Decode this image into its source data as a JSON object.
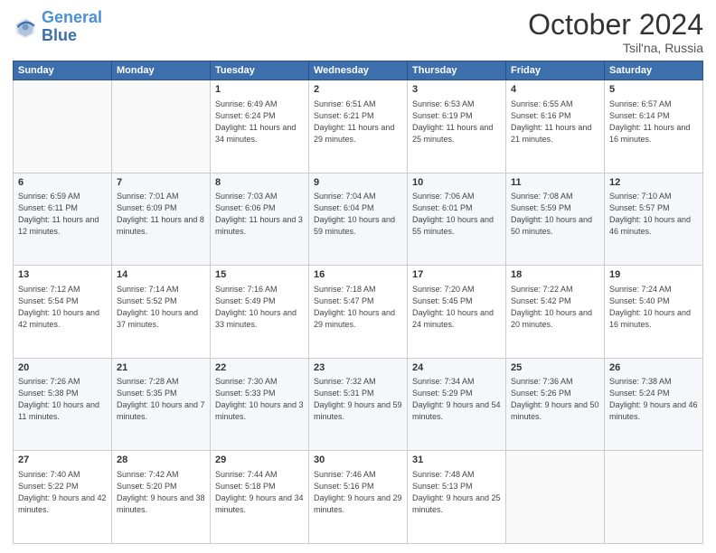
{
  "header": {
    "logo": "GeneralBlue",
    "month": "October 2024",
    "location": "Tsil'na, Russia"
  },
  "weekdays": [
    "Sunday",
    "Monday",
    "Tuesday",
    "Wednesday",
    "Thursday",
    "Friday",
    "Saturday"
  ],
  "weeks": [
    [
      null,
      null,
      {
        "day": 1,
        "sunrise": "6:49 AM",
        "sunset": "6:24 PM",
        "daylight": "11 hours and 34 minutes."
      },
      {
        "day": 2,
        "sunrise": "6:51 AM",
        "sunset": "6:21 PM",
        "daylight": "11 hours and 29 minutes."
      },
      {
        "day": 3,
        "sunrise": "6:53 AM",
        "sunset": "6:19 PM",
        "daylight": "11 hours and 25 minutes."
      },
      {
        "day": 4,
        "sunrise": "6:55 AM",
        "sunset": "6:16 PM",
        "daylight": "11 hours and 21 minutes."
      },
      {
        "day": 5,
        "sunrise": "6:57 AM",
        "sunset": "6:14 PM",
        "daylight": "11 hours and 16 minutes."
      }
    ],
    [
      {
        "day": 6,
        "sunrise": "6:59 AM",
        "sunset": "6:11 PM",
        "daylight": "11 hours and 12 minutes."
      },
      {
        "day": 7,
        "sunrise": "7:01 AM",
        "sunset": "6:09 PM",
        "daylight": "11 hours and 8 minutes."
      },
      {
        "day": 8,
        "sunrise": "7:03 AM",
        "sunset": "6:06 PM",
        "daylight": "11 hours and 3 minutes."
      },
      {
        "day": 9,
        "sunrise": "7:04 AM",
        "sunset": "6:04 PM",
        "daylight": "10 hours and 59 minutes."
      },
      {
        "day": 10,
        "sunrise": "7:06 AM",
        "sunset": "6:01 PM",
        "daylight": "10 hours and 55 minutes."
      },
      {
        "day": 11,
        "sunrise": "7:08 AM",
        "sunset": "5:59 PM",
        "daylight": "10 hours and 50 minutes."
      },
      {
        "day": 12,
        "sunrise": "7:10 AM",
        "sunset": "5:57 PM",
        "daylight": "10 hours and 46 minutes."
      }
    ],
    [
      {
        "day": 13,
        "sunrise": "7:12 AM",
        "sunset": "5:54 PM",
        "daylight": "10 hours and 42 minutes."
      },
      {
        "day": 14,
        "sunrise": "7:14 AM",
        "sunset": "5:52 PM",
        "daylight": "10 hours and 37 minutes."
      },
      {
        "day": 15,
        "sunrise": "7:16 AM",
        "sunset": "5:49 PM",
        "daylight": "10 hours and 33 minutes."
      },
      {
        "day": 16,
        "sunrise": "7:18 AM",
        "sunset": "5:47 PM",
        "daylight": "10 hours and 29 minutes."
      },
      {
        "day": 17,
        "sunrise": "7:20 AM",
        "sunset": "5:45 PM",
        "daylight": "10 hours and 24 minutes."
      },
      {
        "day": 18,
        "sunrise": "7:22 AM",
        "sunset": "5:42 PM",
        "daylight": "10 hours and 20 minutes."
      },
      {
        "day": 19,
        "sunrise": "7:24 AM",
        "sunset": "5:40 PM",
        "daylight": "10 hours and 16 minutes."
      }
    ],
    [
      {
        "day": 20,
        "sunrise": "7:26 AM",
        "sunset": "5:38 PM",
        "daylight": "10 hours and 11 minutes."
      },
      {
        "day": 21,
        "sunrise": "7:28 AM",
        "sunset": "5:35 PM",
        "daylight": "10 hours and 7 minutes."
      },
      {
        "day": 22,
        "sunrise": "7:30 AM",
        "sunset": "5:33 PM",
        "daylight": "10 hours and 3 minutes."
      },
      {
        "day": 23,
        "sunrise": "7:32 AM",
        "sunset": "5:31 PM",
        "daylight": "9 hours and 59 minutes."
      },
      {
        "day": 24,
        "sunrise": "7:34 AM",
        "sunset": "5:29 PM",
        "daylight": "9 hours and 54 minutes."
      },
      {
        "day": 25,
        "sunrise": "7:36 AM",
        "sunset": "5:26 PM",
        "daylight": "9 hours and 50 minutes."
      },
      {
        "day": 26,
        "sunrise": "7:38 AM",
        "sunset": "5:24 PM",
        "daylight": "9 hours and 46 minutes."
      }
    ],
    [
      {
        "day": 27,
        "sunrise": "7:40 AM",
        "sunset": "5:22 PM",
        "daylight": "9 hours and 42 minutes."
      },
      {
        "day": 28,
        "sunrise": "7:42 AM",
        "sunset": "5:20 PM",
        "daylight": "9 hours and 38 minutes."
      },
      {
        "day": 29,
        "sunrise": "7:44 AM",
        "sunset": "5:18 PM",
        "daylight": "9 hours and 34 minutes."
      },
      {
        "day": 30,
        "sunrise": "7:46 AM",
        "sunset": "5:16 PM",
        "daylight": "9 hours and 29 minutes."
      },
      {
        "day": 31,
        "sunrise": "7:48 AM",
        "sunset": "5:13 PM",
        "daylight": "9 hours and 25 minutes."
      },
      null,
      null
    ]
  ],
  "labels": {
    "sunrise": "Sunrise:",
    "sunset": "Sunset:",
    "daylight": "Daylight:"
  }
}
